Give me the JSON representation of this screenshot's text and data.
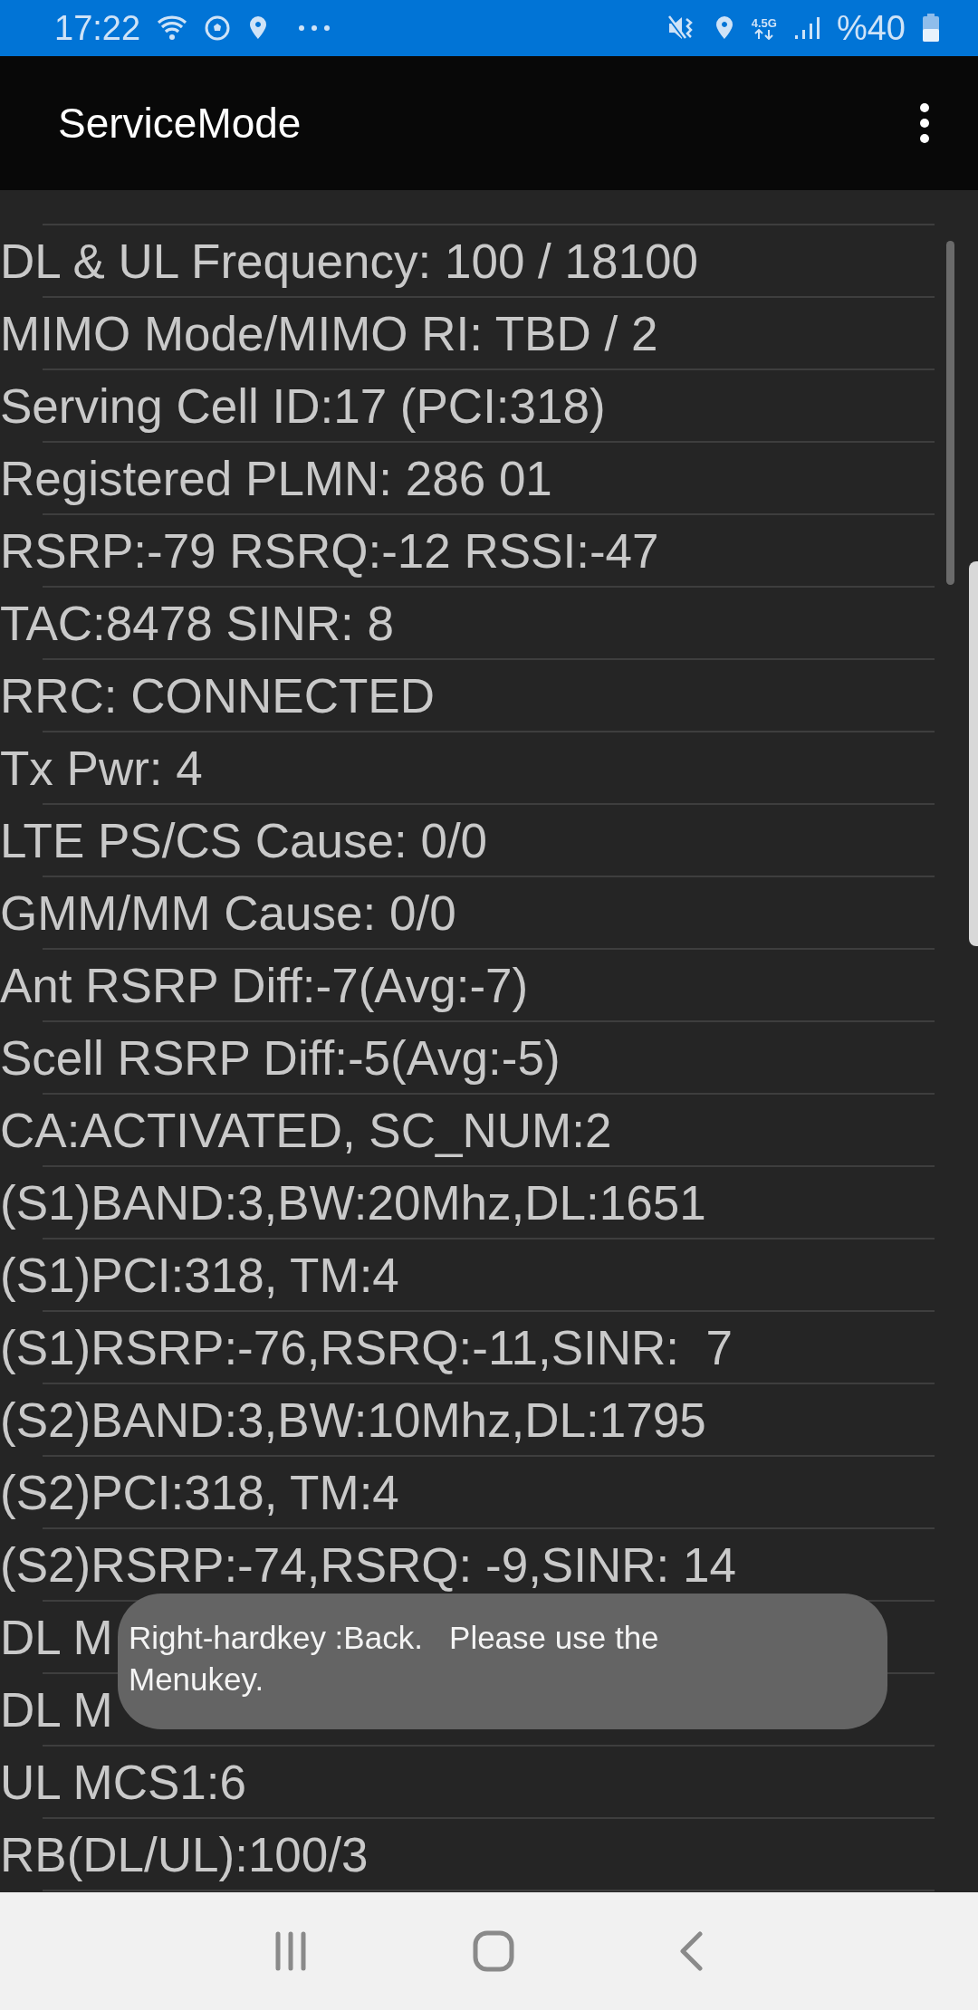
{
  "status_bar": {
    "time": "17:22",
    "network_type": "4.5G",
    "battery": "%40"
  },
  "app_bar": {
    "title": "ServiceMode"
  },
  "rows": [
    "DL & UL Frequency: 100 / 18100",
    "MIMO Mode/MIMO RI: TBD / 2",
    "Serving Cell ID:17 (PCI:318)",
    "Registered PLMN: 286 01",
    "RSRP:-79 RSRQ:-12 RSSI:-47",
    "TAC:8478 SINR: 8",
    "RRC: CONNECTED",
    "Tx Pwr: 4",
    "LTE PS/CS Cause: 0/0",
    "GMM/MM Cause: 0/0",
    "Ant RSRP Diff:-7(Avg:-7)",
    "Scell RSRP Diff:-5(Avg:-5)",
    "CA:ACTIVATED, SC_NUM:2",
    "(S1)BAND:3,BW:20Mhz,DL:1651",
    "(S1)PCI:318, TM:4",
    "(S1)RSRP:-76,RSRQ:-11,SINR:  7",
    "(S2)BAND:3,BW:10Mhz,DL:1795",
    "(S2)PCI:318, TM:4",
    "(S2)RSRP:-74,RSRQ: -9,SINR: 14",
    "DL M",
    "DL M",
    "UL MCS1:6",
    "RB(DL/UL):100/3"
  ],
  "toast": {
    "message": "Right-hardkey :Back.   Please use the Menukey."
  }
}
